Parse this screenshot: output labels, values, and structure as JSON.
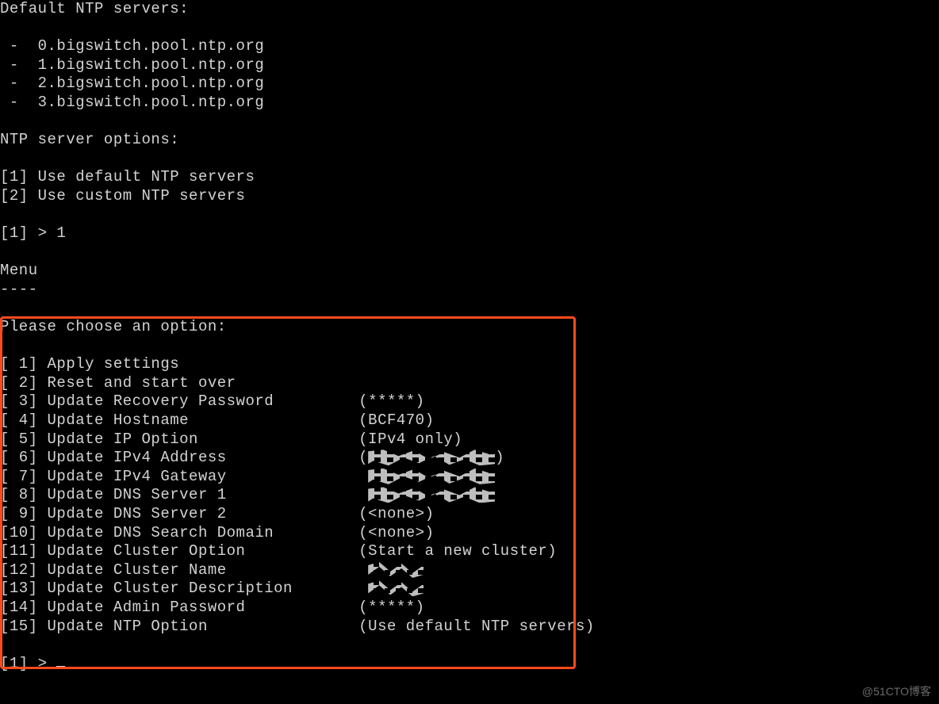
{
  "ntp": {
    "header": "Default NTP servers:",
    "servers": [
      " -  0.bigswitch.pool.ntp.org",
      " -  1.bigswitch.pool.ntp.org",
      " -  2.bigswitch.pool.ntp.org",
      " -  3.bigswitch.pool.ntp.org"
    ],
    "options_header": "NTP server options:",
    "options": [
      "[1] Use default NTP servers",
      "[2] Use custom NTP servers"
    ],
    "prompt": "[1] > 1"
  },
  "menu": {
    "title": "Menu",
    "rule": "----",
    "choose": "Please choose an option:",
    "items": [
      {
        "idx": "[ 1] ",
        "label": "Apply settings",
        "value": ""
      },
      {
        "idx": "[ 2] ",
        "label": "Reset and start over",
        "value": ""
      },
      {
        "idx": "[ 3] ",
        "label": "Update Recovery Password",
        "value": " (*****)"
      },
      {
        "idx": "[ 4] ",
        "label": "Update Hostname",
        "value": " (BCF470)"
      },
      {
        "idx": "[ 5] ",
        "label": "Update IP Option",
        "value": " (IPv4 only)"
      },
      {
        "idx": "[ 6] ",
        "label": "Update IPv4 Address",
        "value": " (",
        "redact": "long",
        "tail": ")"
      },
      {
        "idx": "[ 7] ",
        "label": "Update IPv4 Gateway",
        "value": "  ",
        "redact": "long",
        "tail": ""
      },
      {
        "idx": "[ 8] ",
        "label": "Update DNS Server 1",
        "value": "  ",
        "redact": "long",
        "tail": ""
      },
      {
        "idx": "[ 9] ",
        "label": "Update DNS Server 2",
        "value": " (<none>)"
      },
      {
        "idx": "[10] ",
        "label": "Update DNS Search Domain",
        "value": " (<none>)"
      },
      {
        "idx": "[11] ",
        "label": "Update Cluster Option",
        "value": " (Start a new cluster)"
      },
      {
        "idx": "[12] ",
        "label": "Update Cluster Name",
        "value": "  ",
        "redact": "short",
        "tail": ""
      },
      {
        "idx": "[13] ",
        "label": "Update Cluster Description",
        "value": "  ",
        "redact": "short",
        "tail": ""
      },
      {
        "idx": "[14] ",
        "label": "Update Admin Password",
        "value": " (*****)"
      },
      {
        "idx": "[15] ",
        "label": "Update NTP Option",
        "value": " (Use default NTP servers)"
      }
    ],
    "final_prompt": "[1] > "
  },
  "watermark": "@51CTO博客"
}
